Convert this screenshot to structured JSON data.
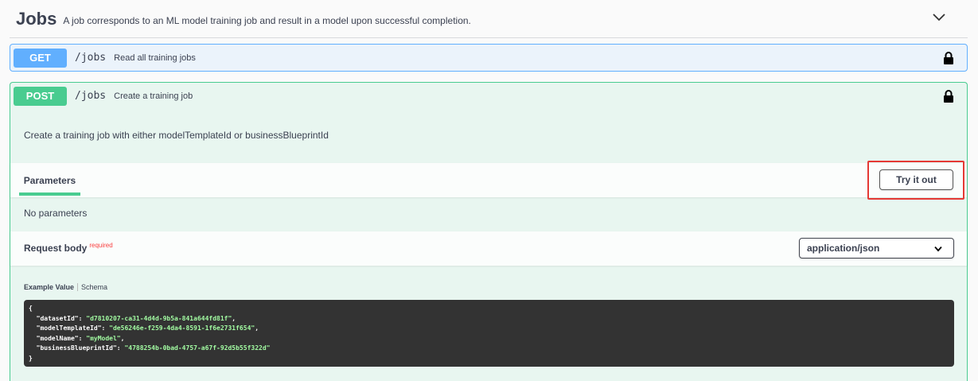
{
  "tag": {
    "title": "Jobs",
    "description": "A job corresponds to an ML model training job and result in a model upon successful completion."
  },
  "get_op": {
    "method": "GET",
    "path": "/jobs",
    "summary": "Read all training jobs"
  },
  "post_op": {
    "method": "POST",
    "path": "/jobs",
    "summary": "Create a training job",
    "description": "Create a training job with either modelTemplateId or businessBlueprintId",
    "parameters_tab": "Parameters",
    "try_it_out": "Try it out",
    "no_parameters": "No parameters",
    "request_body_label": "Request body",
    "required_label": "required",
    "content_type": "application/json",
    "example_tab": "Example Value",
    "schema_tab": "Schema",
    "example": {
      "open": "{",
      "close": "}",
      "fields": [
        {
          "key": "\"datasetId\"",
          "value": "\"d7810207-ca31-4d4d-9b5a-841a644fd81f\"",
          "sep": ","
        },
        {
          "key": "\"modelTemplateId\"",
          "value": "\"de56246e-f259-4da4-8591-1f6e2731f654\"",
          "sep": ","
        },
        {
          "key": "\"modelName\"",
          "value": "\"myModel\"",
          "sep": ","
        },
        {
          "key": "\"businessBlueprintId\"",
          "value": "\"4788254b-0bad-4757-a67f-92d5b55f322d\"",
          "sep": ""
        }
      ]
    }
  },
  "colors": {
    "get": "#61affe",
    "post": "#49cc90",
    "highlight": "#e53935"
  }
}
